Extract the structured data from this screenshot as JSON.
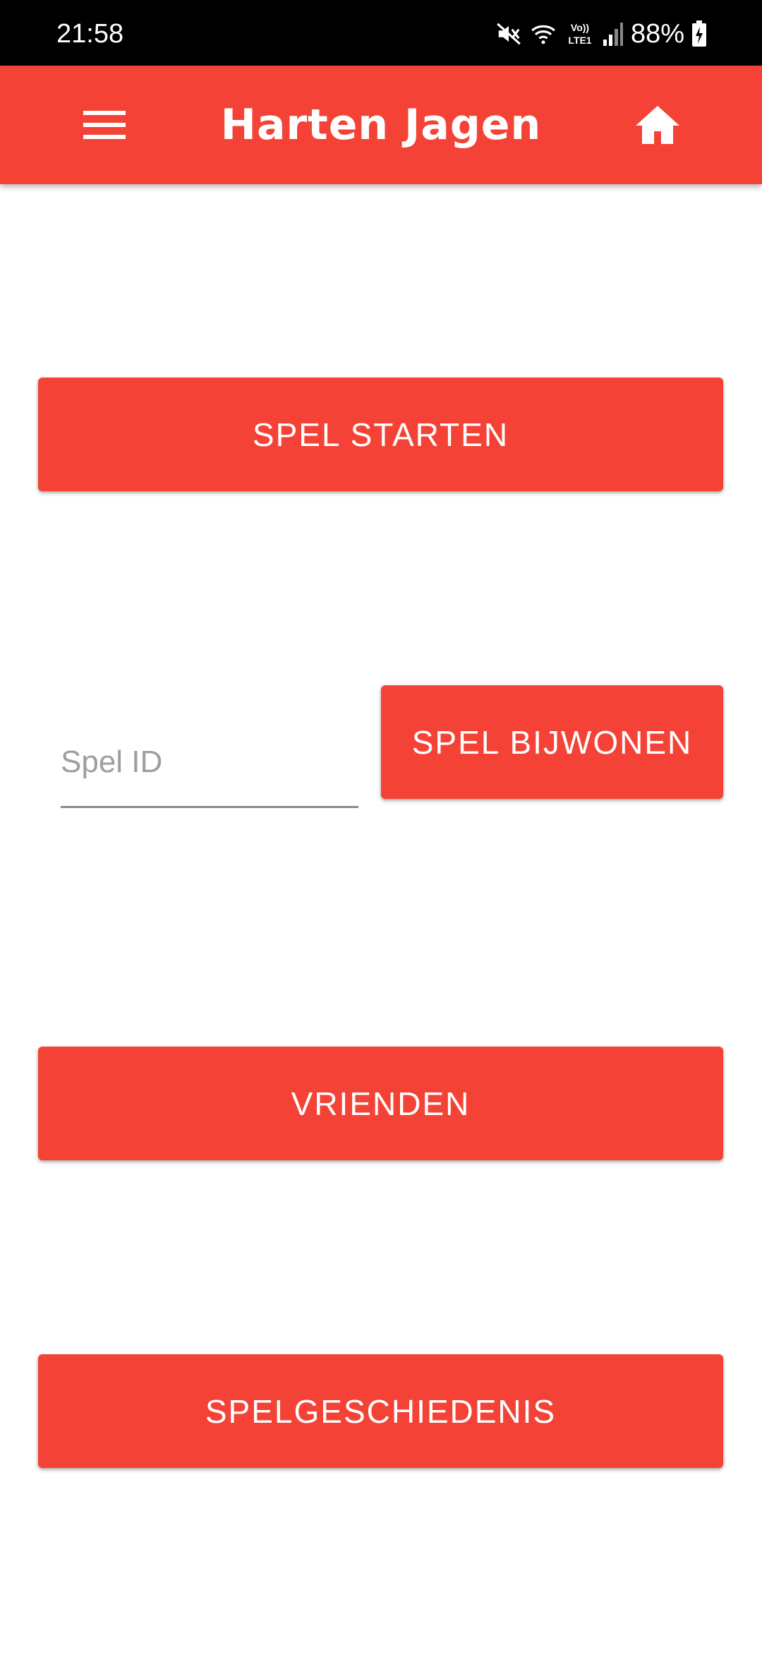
{
  "status_bar": {
    "time": "21:58",
    "battery_percent": "88%",
    "network_label": "Vo)) LTE1"
  },
  "app_bar": {
    "title": "Harten Jagen"
  },
  "actions": {
    "start_game": "SPEL STARTEN",
    "join_game": "SPEL BIJWONEN",
    "friends": "VRIENDEN",
    "game_history": "SPELGESCHIEDENIS"
  },
  "join": {
    "game_id_value": "",
    "game_id_placeholder": "Spel ID"
  },
  "theme": {
    "accent": "#f44336"
  }
}
